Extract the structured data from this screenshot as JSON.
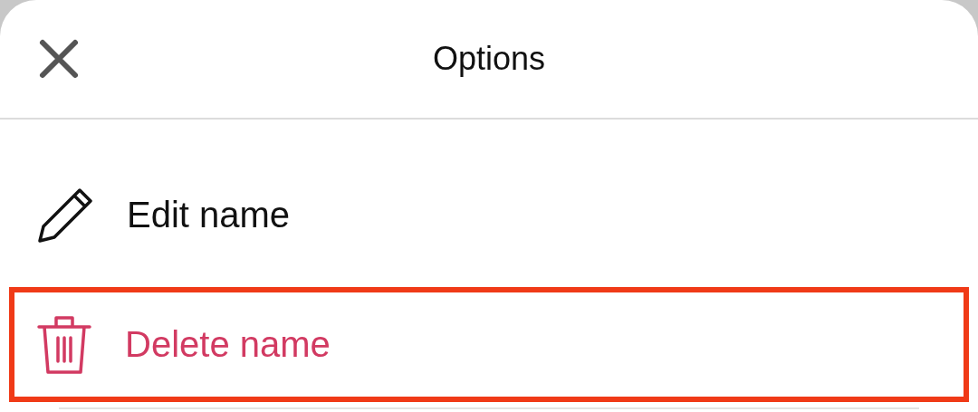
{
  "header": {
    "title": "Options"
  },
  "items": [
    {
      "kind": "edit",
      "label": "Edit name",
      "color": "#111111",
      "highlighted": false
    },
    {
      "kind": "delete",
      "label": "Delete name",
      "color": "#d23a62",
      "highlighted": true
    }
  ]
}
